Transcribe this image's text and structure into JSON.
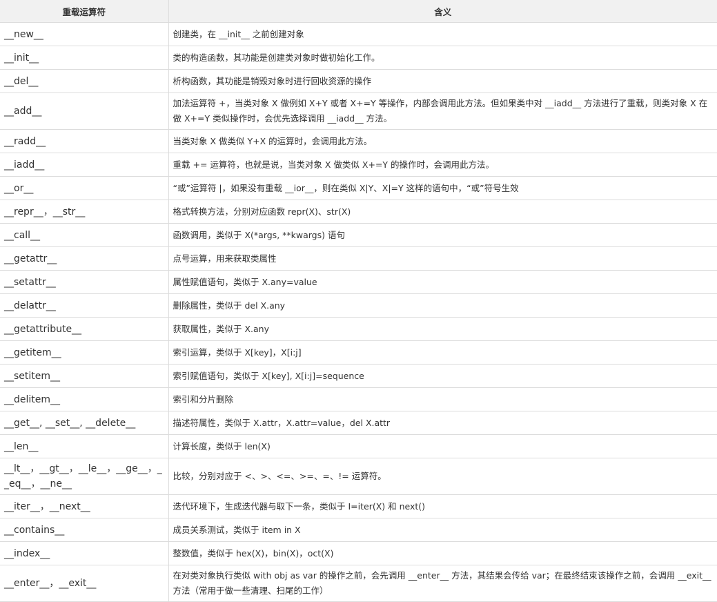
{
  "table": {
    "headers": [
      "重载运算符",
      "含义"
    ],
    "rows": [
      {
        "op": "__new__",
        "desc": "创建类，在 __init__ 之前创建对象"
      },
      {
        "op": "__init__",
        "desc": "类的构造函数，其功能是创建类对象时做初始化工作。"
      },
      {
        "op": "__del__",
        "desc": "析构函数，其功能是销毁对象时进行回收资源的操作"
      },
      {
        "op": "__add__",
        "desc": "加法运算符 +，当类对象 X 做例如 X+Y 或者 X+=Y 等操作，内部会调用此方法。但如果类中对 __iadd__ 方法进行了重载，则类对象 X 在做 X+=Y 类似操作时，会优先选择调用 __iadd__ 方法。"
      },
      {
        "op": "__radd__",
        "desc": "当类对象 X 做类似 Y+X 的运算时，会调用此方法。"
      },
      {
        "op": "__iadd__",
        "desc": "重载 += 运算符，也就是说，当类对象 X 做类似 X+=Y 的操作时，会调用此方法。"
      },
      {
        "op": "__or__",
        "desc": "“或”运算符 |，如果没有重载 __ior__，则在类似 X|Y、X|=Y 这样的语句中，“或”符号生效"
      },
      {
        "op": "__repr__，__str__",
        "desc": "格式转换方法，分别对应函数 repr(X)、str(X)"
      },
      {
        "op": "__call__",
        "desc": "函数调用，类似于 X(*args, **kwargs) 语句"
      },
      {
        "op": "__getattr__",
        "desc": "点号运算，用来获取类属性"
      },
      {
        "op": "__setattr__",
        "desc": "属性赋值语句，类似于 X.any=value"
      },
      {
        "op": "__delattr__",
        "desc": "删除属性，类似于 del X.any"
      },
      {
        "op": "__getattribute__",
        "desc": "获取属性，类似于 X.any"
      },
      {
        "op": "__getitem__",
        "desc": "索引运算，类似于 X[key]，X[i:j]"
      },
      {
        "op": "__setitem__",
        "desc": "索引赋值语句，类似于 X[key], X[i:j]=sequence"
      },
      {
        "op": "__delitem__",
        "desc": "索引和分片删除"
      },
      {
        "op": "__get__, __set__, __delete__",
        "desc": "描述符属性，类似于 X.attr，X.attr=value，del X.attr"
      },
      {
        "op": "__len__",
        "desc": "计算长度，类似于 len(X)"
      },
      {
        "op": "__lt__，__gt__，__le__，__ge__，__eq__，__ne__",
        "desc": "比较，分别对应于 <、>、<=、>=、=、!= 运算符。"
      },
      {
        "op": "__iter__，__next__",
        "desc": "迭代环境下，生成迭代器与取下一条，类似于 I=iter(X) 和 next()"
      },
      {
        "op": "__contains__",
        "desc": "成员关系测试，类似于 item in X"
      },
      {
        "op": "__index__",
        "desc": "整数值，类似于 hex(X)，bin(X)，oct(X)"
      },
      {
        "op": "__enter__，__exit__",
        "desc": "在对类对象执行类似 with obj as var 的操作之前，会先调用 __enter__ 方法，其结果会传给 var；在最终结束该操作之前，会调用 __exit__ 方法（常用于做一些清理、扫尾的工作）"
      }
    ]
  }
}
